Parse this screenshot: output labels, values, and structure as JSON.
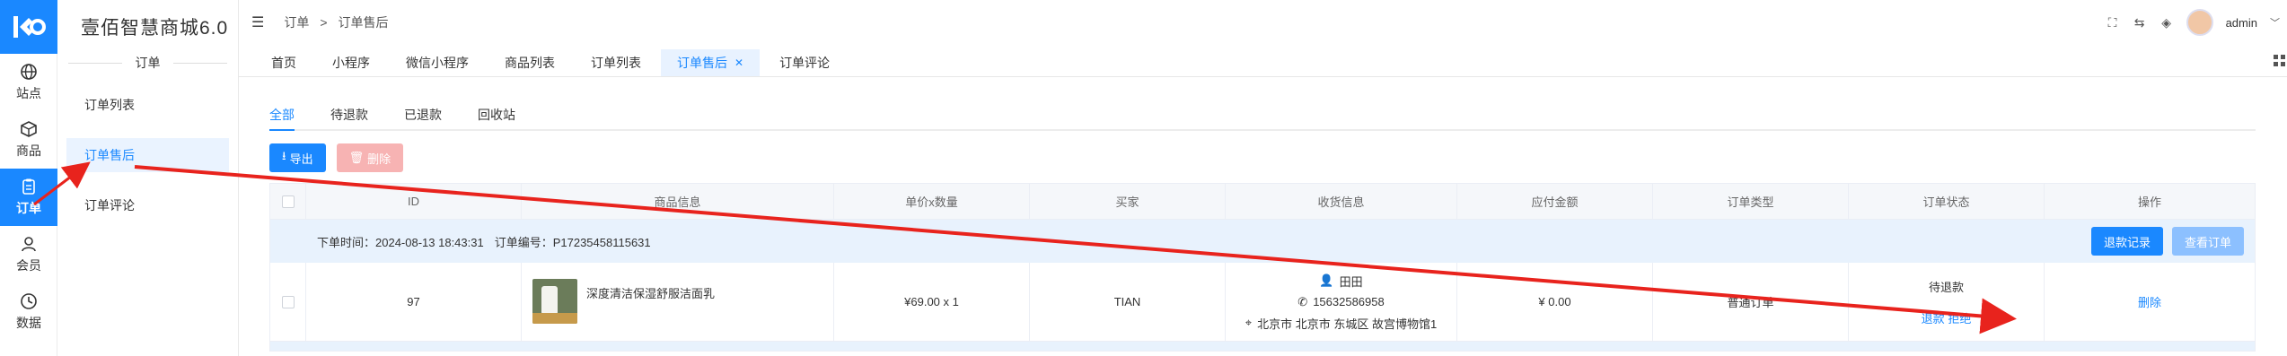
{
  "rail": {
    "items": [
      {
        "label": "站点",
        "icon": "globe-icon"
      },
      {
        "label": "商品",
        "icon": "box-icon"
      },
      {
        "label": "订单",
        "icon": "clipboard-icon"
      },
      {
        "label": "会员",
        "icon": "user-icon"
      },
      {
        "label": "数据",
        "icon": "clock-icon"
      }
    ]
  },
  "brand": "壹佰智慧商城6.0",
  "subnav": {
    "title": "订单",
    "items": [
      "订单列表",
      "订单售后",
      "订单评论"
    ]
  },
  "header": {
    "breadcrumb": [
      "订单",
      ">",
      "订单售后"
    ],
    "user": "admin"
  },
  "tabs": [
    "首页",
    "小程序",
    "微信小程序",
    "商品列表",
    "订单列表",
    "订单售后",
    "订单评论"
  ],
  "subtabs": [
    "全部",
    "待退款",
    "已退款",
    "回收站"
  ],
  "toolbar": {
    "export": "导出",
    "delete": "删除"
  },
  "table": {
    "headers": [
      "ID",
      "商品信息",
      "单价x数量",
      "买家",
      "收货信息",
      "应付金额",
      "订单类型",
      "订单状态",
      "操作"
    ],
    "group": {
      "order_time": "下单时间：2024-08-13 18:43:31",
      "order_no": "订单编号：P17235458115631",
      "refund_record": "退款记录",
      "view_order": "查看订单"
    },
    "row": {
      "id": "97",
      "goods": "深度清洁保湿舒服洁面乳",
      "price_qty": "¥69.00 x 1",
      "buyer": "TIAN",
      "receiver": "田田",
      "phone": "15632586958",
      "address": "北京市 北京市 东城区 故宫博物馆1",
      "amount": "¥ 0.00",
      "type": "普通订单",
      "status": "待退款",
      "action_refund": "退款",
      "action_reject": "拒绝",
      "action_delete": "删除"
    }
  },
  "colors": {
    "accent": "#1a88ff",
    "annotation": "#e8231d"
  }
}
